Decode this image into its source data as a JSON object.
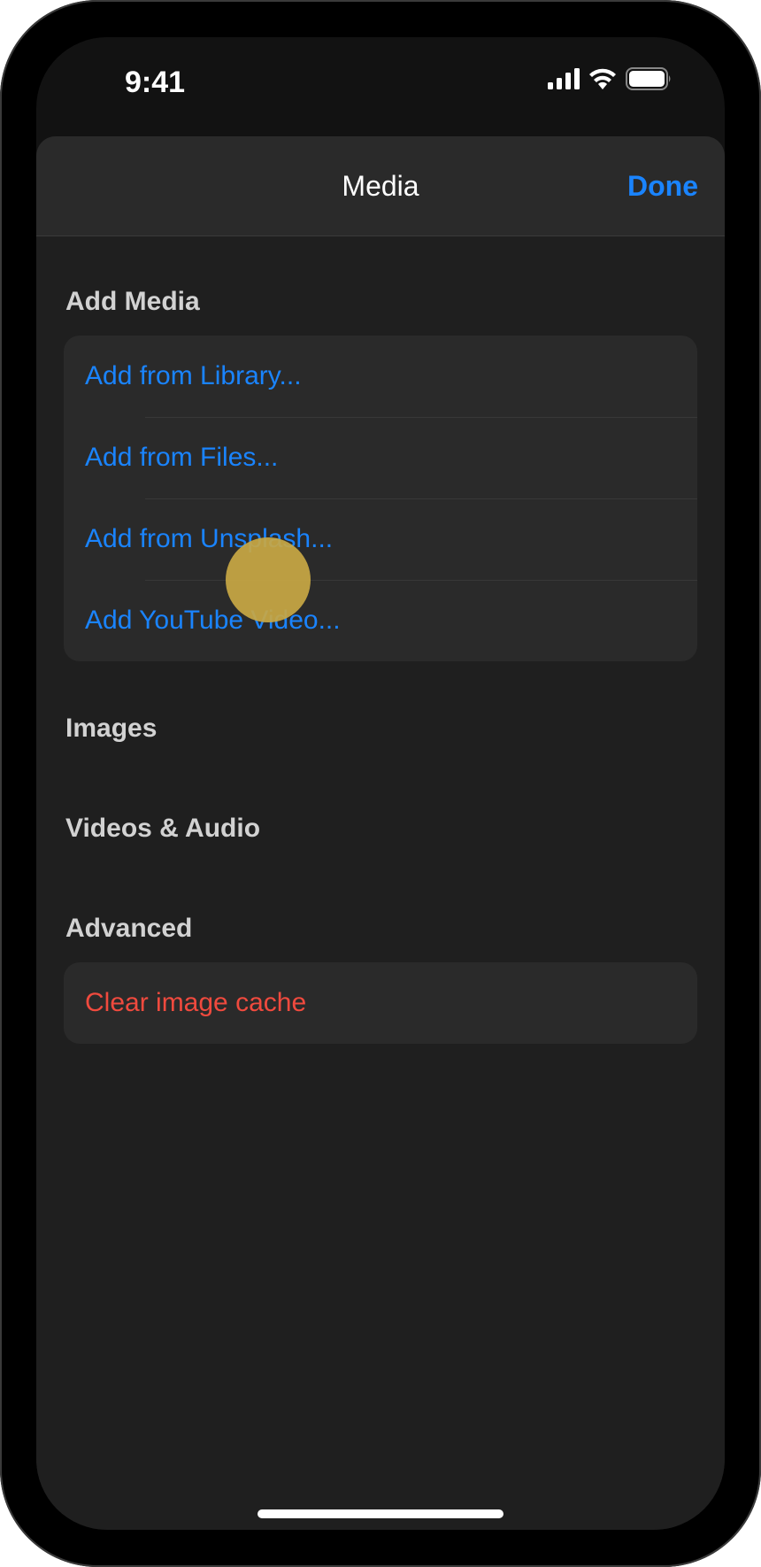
{
  "status_bar": {
    "time": "9:41",
    "icons": [
      "cellular-signal-icon",
      "wifi-icon",
      "battery-icon"
    ]
  },
  "sheet": {
    "title": "Media",
    "done_label": "Done"
  },
  "sections": {
    "add_media": {
      "header": "Add Media",
      "items": [
        {
          "label": "Add from Library..."
        },
        {
          "label": "Add from Files..."
        },
        {
          "label": "Add from Unsplash..."
        },
        {
          "label": "Add YouTube Video..."
        }
      ]
    },
    "images": {
      "header": "Images"
    },
    "videos_audio": {
      "header": "Videos & Audio"
    },
    "advanced": {
      "header": "Advanced",
      "items": [
        {
          "label": "Clear image cache"
        }
      ]
    }
  },
  "colors": {
    "accent": "#1a84ff",
    "destructive": "#f04a3e",
    "touch_indicator": "#c9a844"
  }
}
